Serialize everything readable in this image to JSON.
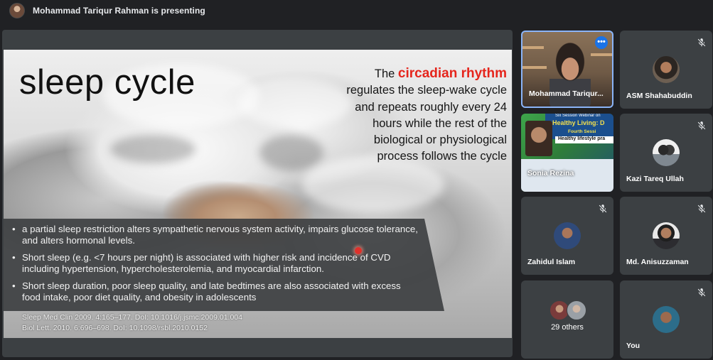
{
  "presenting": {
    "text": "Mohammad Tariqur Rahman is presenting"
  },
  "slide": {
    "title": "sleep cycle",
    "right_prefix": "The ",
    "right_highlight": "circadian rhythm",
    "right_rest": " regulates the sleep-wake cycle and repeats roughly every 24 hours while the rest of the biological or physiological process follows the cycle",
    "bullets": [
      "a partial sleep restriction alters sympathetic nervous system activity, impairs glucose tolerance, and alters hormonal levels.",
      "Short sleep (e.g. <7 hours per night) is associated with higher risk and incidence of CVD including hypertension, hypercholesterolemia, and myocardial infarction.",
      "Short sleep duration, poor sleep quality, and late bedtimes are also associated with excess food intake, poor diet quality, and obesity in adolescents"
    ],
    "refs": [
      "Sleep Med Clin 2009. 4:165–177. DoI: 10.1016/j.jsmc.2009.01.004",
      "Biol Lett. 2010. 6:696–698. DoI: 10.1098/rsbl.2010.0152"
    ]
  },
  "participants": {
    "presenter_name": "Mohammad Tariqur...",
    "sonia": "Sonia Rezina",
    "asm": "ASM Shahabuddin",
    "kazi": "Kazi Tareq Ullah",
    "zahidul": "Zahidul Islam",
    "anisuzzaman": "Md. Anisuzzaman",
    "others": "29 others",
    "you": "You"
  },
  "poster": {
    "line1": "Six Session Webinar on",
    "line2": "Healthy Living: D",
    "line3": "Fourth Sessi",
    "line4": "Healthy lifestyle pra"
  },
  "icons": {
    "mute": "mic-off-icon",
    "more": "more-options-icon"
  }
}
